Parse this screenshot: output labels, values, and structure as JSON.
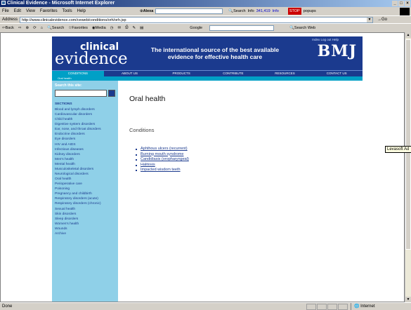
{
  "window": {
    "title": "Clinical Evidence - Microsoft Internet Explorer"
  },
  "menu": [
    "File",
    "Edit",
    "View",
    "Favorites",
    "Tools",
    "Help"
  ],
  "toolbar": {
    "alexa": "Alexa",
    "search": "Search",
    "info": "Info",
    "rank": "341,419",
    "updown": "Info",
    "popups_label": "popups"
  },
  "address": {
    "label": "Address",
    "url": "http://www.clinicalevidence.com/ceweb/conditions/orh/orh.jsp",
    "go": "Go"
  },
  "nav": {
    "back": "Back",
    "search": "Search",
    "favorites": "Favorites",
    "media": "Media",
    "google": "Google",
    "search_web": "Search Web"
  },
  "site": {
    "logo_top": "clinical",
    "logo_bottom": "evidence",
    "tagline": "The international source of the best available evidence for effective health care",
    "brand": "BMJ",
    "toplinks": "Index  Log out  Help",
    "tabs": [
      "CONDITIONS",
      "ABOUT US",
      "PRODUCTS",
      "CONTRIBUTE",
      "RESOURCES",
      "CONTACT US"
    ],
    "subnav": "Oral health",
    "search_label": "Search this site:",
    "sections_heading": "SECTIONS",
    "sections": [
      "Blood and lymph disorders",
      "Cardiovascular disorders",
      "Child health",
      "Digestive system disorders",
      "Ear, nose, and throat disorders",
      "Endocrine disorders",
      "Eye disorders",
      "HIV and AIDS",
      "Infectious diseases",
      "Kidney disorders",
      "Men's health",
      "Mental health",
      "Musculoskeletal disorders",
      "Neurological disorders",
      "Oral health",
      "Perioperative care",
      "Poisoning",
      "Pregnancy and childbirth",
      "Respiratory disorders (acute)",
      "Respiratory disorders (chronic)",
      "Sexual health",
      "Skin disorders",
      "Sleep disorders",
      "Women's health",
      "Wounds",
      "Archive"
    ],
    "page_title": "Oral health",
    "conditions_heading": "Conditions",
    "conditions": [
      "Aphthous ulcers (recurrent)",
      "Burning mouth syndrome",
      "Candidiasis (oropharyngeal)",
      "Halitosis",
      "Impacted wisdom teeth"
    ]
  },
  "tooltip": "Levasoft Ad",
  "status": {
    "text": "Done",
    "zone": "Internet"
  }
}
